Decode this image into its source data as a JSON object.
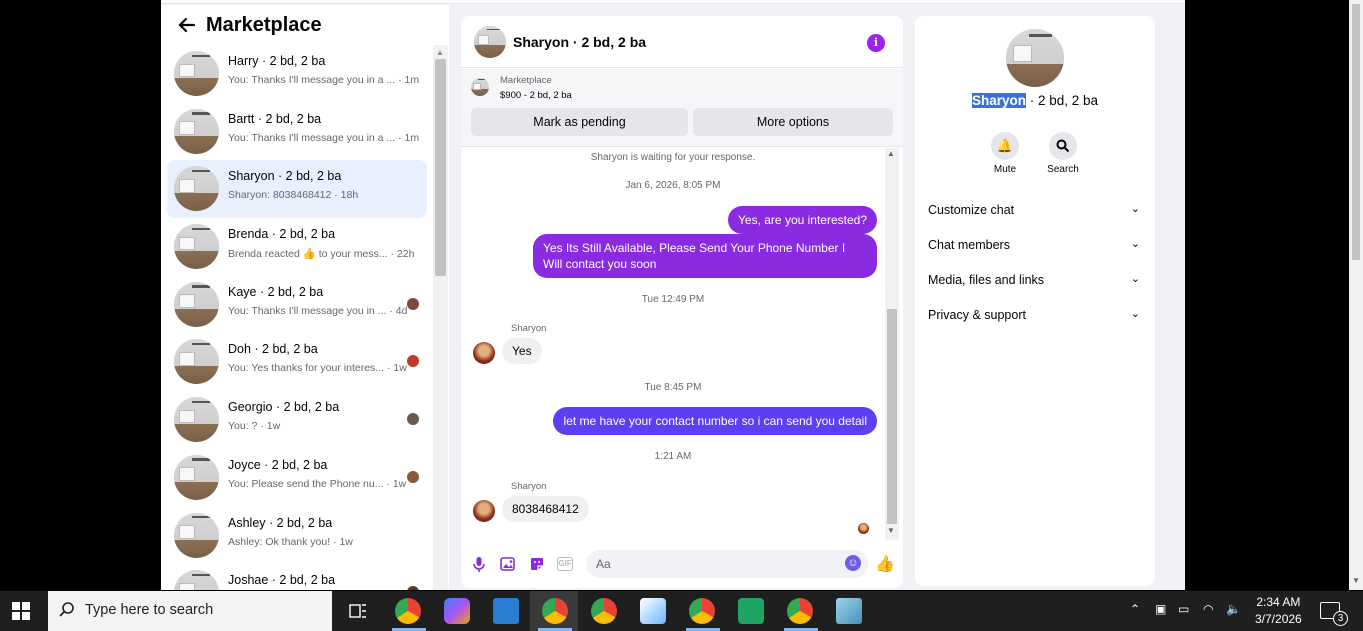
{
  "marketplace": {
    "title": "Marketplace",
    "conversations": [
      {
        "name": "Harry · 2 bd, 2 ba",
        "preview": "You: Thanks I'll message you in a ... · 1m",
        "active": false,
        "mini_avatar": false
      },
      {
        "name": "Bartt · 2 bd, 2 ba",
        "preview": "You: Thanks I'll message you in a ... · 1m",
        "active": false,
        "mini_avatar": false
      },
      {
        "name": "Sharyon · 2 bd, 2 ba",
        "preview": "Sharyon: 8038468412 · 18h",
        "active": true,
        "mini_avatar": false
      },
      {
        "name": "Brenda · 2 bd, 2 ba",
        "preview": "Brenda reacted 👍 to your mess... · 22h",
        "active": false,
        "mini_avatar": false
      },
      {
        "name": "Kaye · 2 bd, 2 ba",
        "preview": "You: Thanks I'll message you in ... · 4d",
        "active": false,
        "mini_avatar": true
      },
      {
        "name": "Doh · 2 bd, 2 ba",
        "preview": "You: Yes thanks for your interes... · 1w",
        "active": false,
        "mini_avatar": true
      },
      {
        "name": "Georgio · 2 bd, 2 ba",
        "preview": "You: ? · 1w",
        "active": false,
        "mini_avatar": true
      },
      {
        "name": "Joyce · 2 bd, 2 ba",
        "preview": "You: Please send the Phone nu... · 1w",
        "active": false,
        "mini_avatar": true
      },
      {
        "name": "Ashley · 2 bd, 2 ba",
        "preview": "Ashley: Ok thank you! · 1w",
        "active": false,
        "mini_avatar": false
      },
      {
        "name": "Joshae · 2 bd, 2 ba",
        "preview": "",
        "active": false,
        "mini_avatar": true
      }
    ]
  },
  "chat": {
    "title": "Sharyon · 2 bd, 2 ba",
    "listing_source": "Marketplace",
    "listing_price": "$900 - 2 bd, 2 ba",
    "mark_pending": "Mark as pending",
    "more_options": "More options",
    "waiting": "Sharyon is waiting for your response.",
    "messages": [
      {
        "kind": "time",
        "text": "Jan 6, 2026, 8:05 PM"
      },
      {
        "kind": "out",
        "text": "Yes, are you interested?"
      },
      {
        "kind": "out",
        "text": "Yes Its Still Available, Please Send Your Phone Number I Will contact you soon"
      },
      {
        "kind": "time",
        "text": "Tue 12:49 PM"
      },
      {
        "kind": "sender",
        "text": "Sharyon"
      },
      {
        "kind": "in",
        "text": "Yes"
      },
      {
        "kind": "time",
        "text": "Tue 8:45 PM"
      },
      {
        "kind": "out",
        "text": "let me have your contact number so i can send you detail"
      },
      {
        "kind": "time",
        "text": "1:21 AM"
      },
      {
        "kind": "sender",
        "text": "Sharyon"
      },
      {
        "kind": "in",
        "text": "8038468412"
      }
    ],
    "input_placeholder": "Aa"
  },
  "info_panel": {
    "name_highlight": "Sharyon",
    "name_rest": " · 2 bd, 2 ba",
    "mute": "Mute",
    "search": "Search",
    "sections": [
      "Customize chat",
      "Chat members",
      "Media, files and links",
      "Privacy & support"
    ]
  },
  "taskbar": {
    "search_placeholder": "Type here to search",
    "time": "2:34 AM",
    "date": "3/7/2026",
    "notifications": "3"
  },
  "colors": {
    "accent_purple": "#8a2be2",
    "outgoing_blue": "#5b3ff0",
    "active_conversation": "#e7f0fc"
  }
}
